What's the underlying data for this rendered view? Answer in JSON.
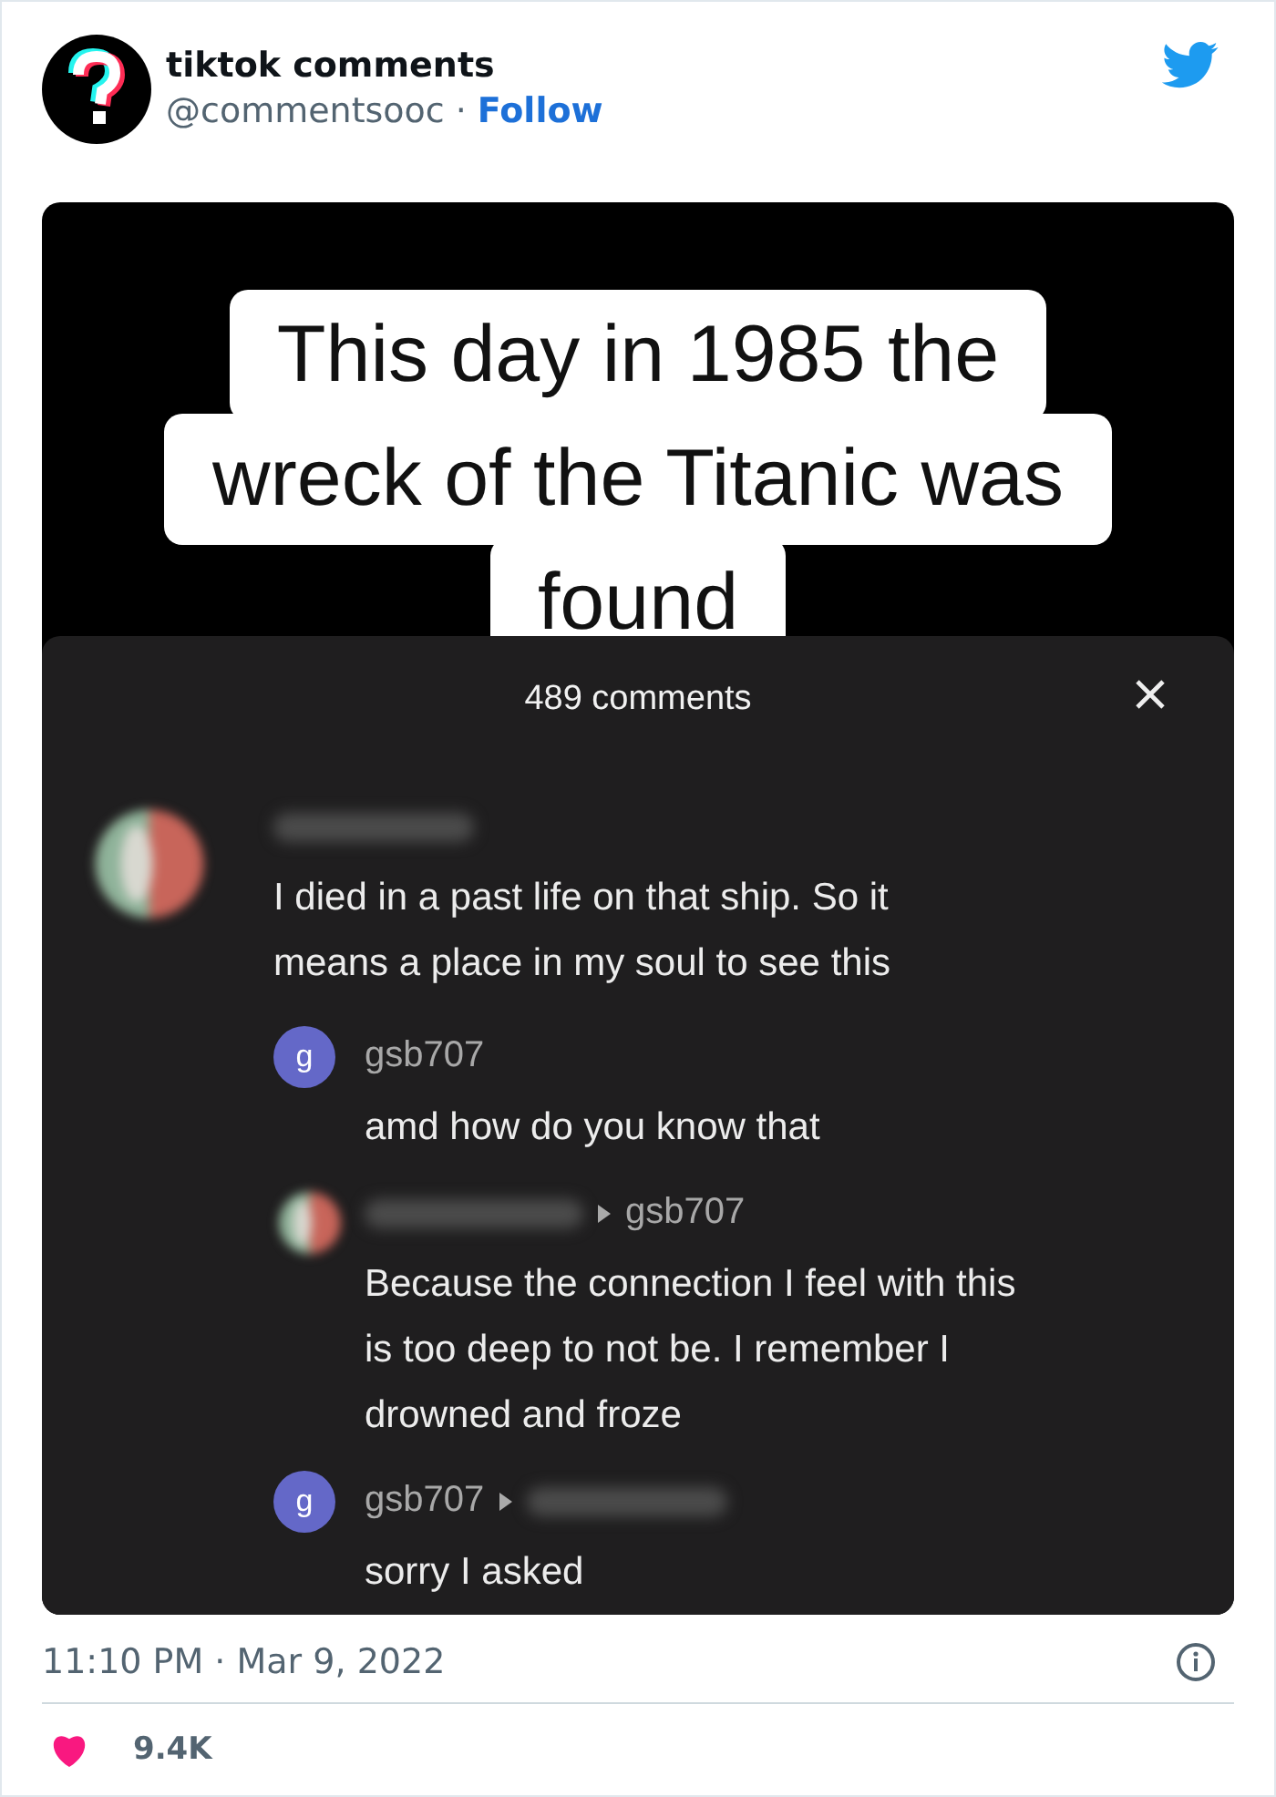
{
  "author": {
    "name": "tiktok comments",
    "handle": "@commentsooc",
    "separator": "·",
    "follow": "Follow"
  },
  "media": {
    "caption_lines": [
      "This day in 1985 the",
      "wreck of the Titanic was",
      "found"
    ],
    "panel": {
      "title": "489 comments",
      "comments": [
        {
          "avatar": {
            "kind": "blurred"
          },
          "author_hidden": true,
          "text": "I died in a past life on that ship. So it means a place in my soul to see this",
          "children": [
            {
              "avatar": {
                "kind": "letter",
                "letter": "g",
                "color": "#6468c8"
              },
              "author": "gsb707",
              "author_hidden": false,
              "text": "amd how do you know that"
            },
            {
              "avatar": {
                "kind": "blurred"
              },
              "author_hidden": true,
              "reply_to": "gsb707",
              "reply_to_hidden": false,
              "text": "Because the connection I feel with this is too deep to not be. I remember I drowned and froze"
            },
            {
              "avatar": {
                "kind": "letter",
                "letter": "g",
                "color": "#6468c8"
              },
              "author": "gsb707",
              "author_hidden": false,
              "reply_to_hidden": true,
              "text": "sorry I asked"
            }
          ]
        }
      ]
    }
  },
  "timestamp": "11:10 PM · Mar 9, 2022",
  "likes": {
    "count": "9.4K"
  }
}
